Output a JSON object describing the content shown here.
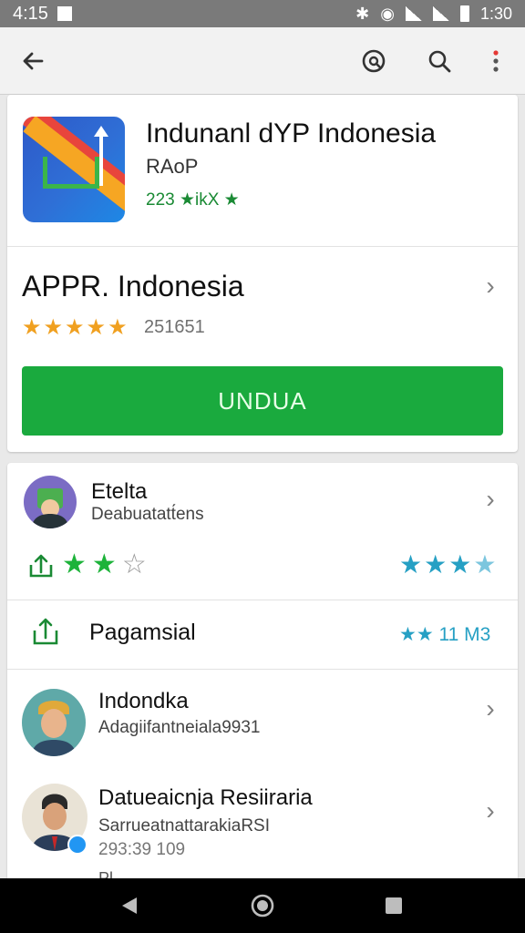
{
  "status_bar": {
    "time_left": "4:15",
    "time_right": "1:30"
  },
  "app_header": {
    "title": "Indunanl dYP Indonesia",
    "subtitle": "RAoP",
    "meta": "223 ★ikX ★"
  },
  "app_detail": {
    "name": "APPR. Indonesia",
    "rating_stars": 5,
    "rating_count": "251651",
    "install_label": "UNDUA"
  },
  "reviews": {
    "r1": {
      "name": "Etelta",
      "subtitle": "Deabuatatt́ens",
      "left_stars_filled": 2,
      "left_stars_total": 3,
      "right_stars": 4
    },
    "r2": {
      "label": "Pagamsial",
      "right_text": "★★ 11 M3"
    },
    "r3": {
      "name": "Indondka",
      "subtitle": "Adagiifantneiala9931"
    },
    "r4": {
      "name": "Datueaicnja Resiiraria",
      "subtitle": "SarrueatnattarakiaRSI",
      "date": "293:39 109"
    },
    "r5_partial": "Pl"
  },
  "colors": {
    "accent_green": "#1aaa3e",
    "star_orange": "#f0a020",
    "star_green": "#1db33a",
    "star_blue": "#26a0c4"
  }
}
